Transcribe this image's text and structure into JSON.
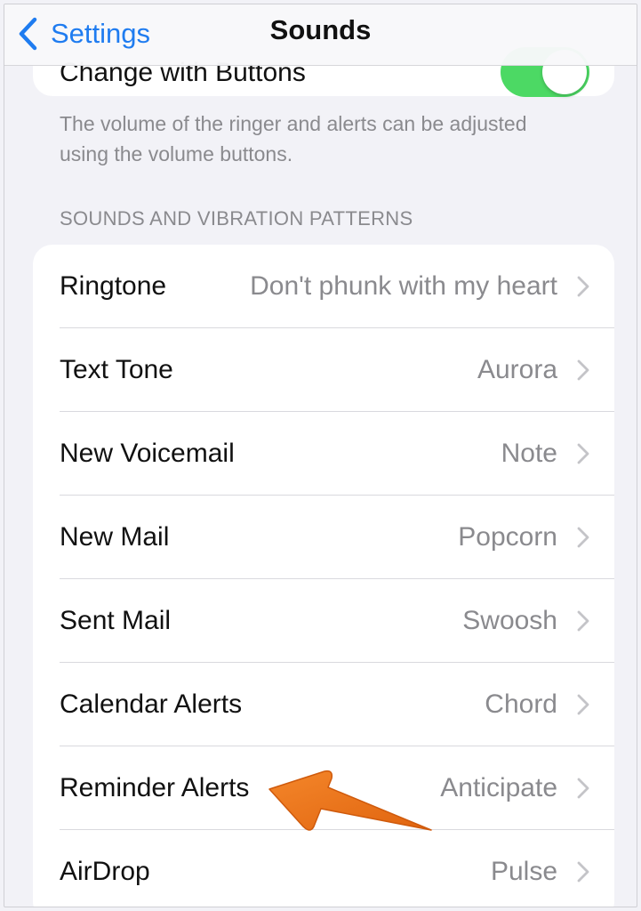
{
  "navbar": {
    "back_label": "Settings",
    "title": "Sounds"
  },
  "previous_section": {
    "toggle_label": "Change with Buttons",
    "toggle_state": "on",
    "toggle_color": "#4cd964",
    "footer": "The volume of the ringer and alerts can be adjusted using the volume buttons."
  },
  "sounds_section": {
    "header": "SOUNDS AND VIBRATION PATTERNS",
    "rows": [
      {
        "label": "Ringtone",
        "value": "Don't phunk with my heart"
      },
      {
        "label": "Text Tone",
        "value": "Aurora"
      },
      {
        "label": "New Voicemail",
        "value": "Note"
      },
      {
        "label": "New Mail",
        "value": "Popcorn"
      },
      {
        "label": "Sent Mail",
        "value": "Swoosh"
      },
      {
        "label": "Calendar Alerts",
        "value": "Chord"
      },
      {
        "label": "Reminder Alerts",
        "value": "Anticipate"
      },
      {
        "label": "AirDrop",
        "value": "Pulse"
      }
    ]
  },
  "annotation": {
    "arrow_color": "#f07a1e",
    "points_to": "Reminder Alerts"
  },
  "colors": {
    "accent": "#1f7cf0",
    "background": "#f2f2f7",
    "secondary_text": "#8a8a8e"
  }
}
